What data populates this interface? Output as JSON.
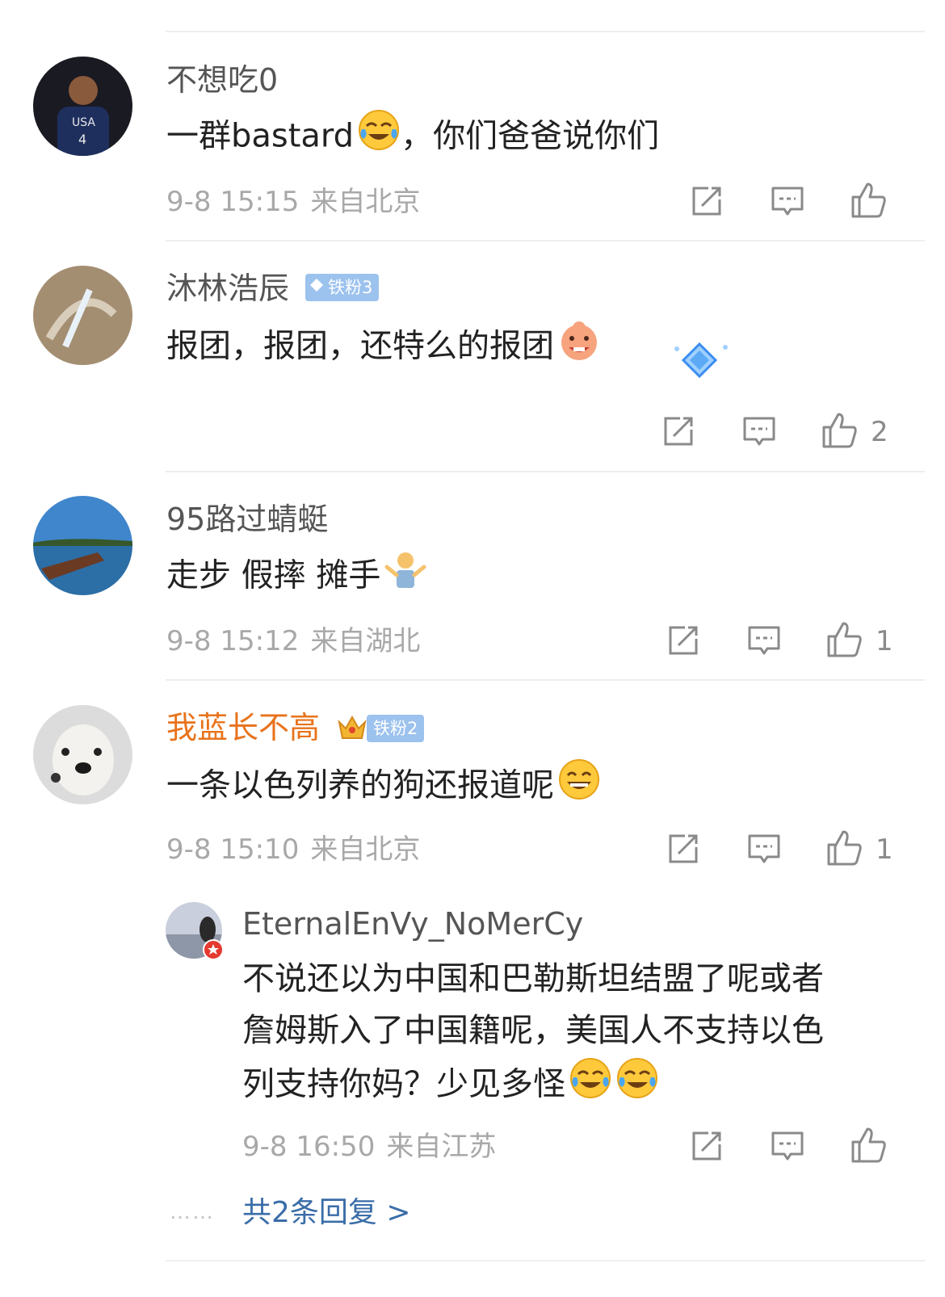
{
  "comments": [
    {
      "username": "不想吃0",
      "text": "一群bastard",
      "text_after_emoji": "，你们爸爸说你们",
      "emoji": "laugh-cry-emoji",
      "time": "9-8 15:15",
      "location": "来自北京",
      "likes": ""
    },
    {
      "username": "沐林浩辰",
      "badge": "铁粉3",
      "text": "报团，报团，还特么的报团",
      "emoji": "grin-emoji",
      "time": "",
      "location": "",
      "likes": "2"
    },
    {
      "username": "95路过蜻蜓",
      "text": "走步 假摔 摊手",
      "emoji": "shrug-emoji",
      "time": "9-8 15:12",
      "location": "来自湖北",
      "likes": "1"
    },
    {
      "username": "我蓝长不高",
      "badge": "铁粉2",
      "text": "一条以色列养的狗还报道呢",
      "emoji": "laugh-emoji",
      "time": "9-8 15:10",
      "location": "来自北京",
      "likes": "1"
    }
  ],
  "reply": {
    "username": "EternalEnVy_NoMerCy",
    "line1": "不说还以为中国和巴勒斯坦结盟了呢或者",
    "line2": "詹姆斯入了中国籍呢，美国人不支持以色",
    "line3": "列支持你妈？少见多怪",
    "emoji": "laugh-cry-emoji",
    "time": "9-8 16:50",
    "location": "来自江苏",
    "more_replies": "共2条回复 >",
    "dots": "……"
  },
  "colors": {
    "username": "#555555",
    "vip_username": "#e8731c",
    "meta": "#a8a8a8",
    "link": "#3a6da8",
    "badge": "#9cc2ee"
  }
}
